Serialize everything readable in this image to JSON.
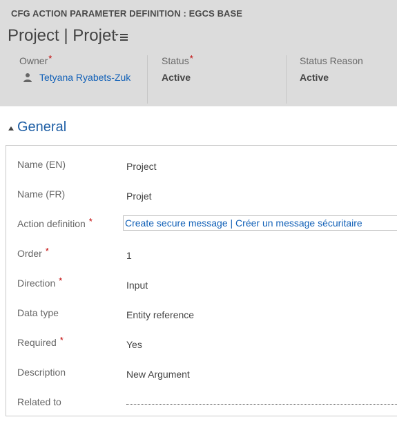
{
  "header": {
    "entity_type": "CFG ACTION PARAMETER DEFINITION : EGCS BASE",
    "record_title": "Project | Projet",
    "owner_label": "Owner",
    "owner_value": "Tetyana Ryabets-Zuk",
    "status_label": "Status",
    "status_value": "Active",
    "status_reason_label": "Status Reason",
    "status_reason_value": "Active",
    "required_marker": "*"
  },
  "section": {
    "title": "General"
  },
  "fields": [
    {
      "label": "Name (EN)",
      "value": "Project"
    },
    {
      "label": "Name (FR)",
      "value": "Projet"
    },
    {
      "label": "Action definition",
      "value": "Create secure message | Créer un message sécuritaire"
    },
    {
      "label": "Order",
      "value": "1"
    },
    {
      "label": "Direction",
      "value": "Input"
    },
    {
      "label": "Data type",
      "value": "Entity reference"
    },
    {
      "label": "Required",
      "value": "Yes"
    },
    {
      "label": "Description",
      "value": "New Argument"
    },
    {
      "label": "Related to",
      "value": ""
    }
  ],
  "colors": {
    "header_bg": "#dcdcdc",
    "link": "#1160b7",
    "section_title": "#1f5fa5",
    "required": "#c00000"
  },
  "icons": [
    "record-menu-icon",
    "user-icon",
    "collapse-triangle-icon"
  ]
}
